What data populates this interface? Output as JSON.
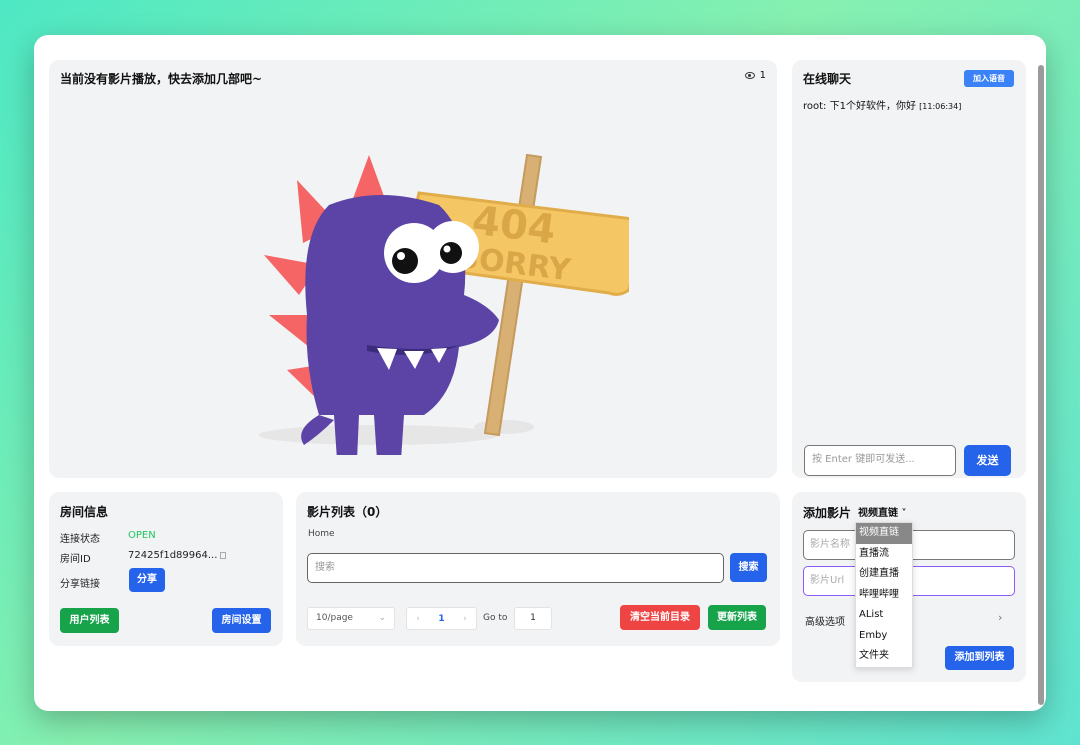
{
  "video": {
    "title": "当前没有影片播放，快去添加几部吧~",
    "viewer_count": "1",
    "error_sign_code": "404",
    "error_sign_text": "SORRY"
  },
  "chat": {
    "title": "在线聊天",
    "voice_button": "加入语音",
    "message_user": "root:",
    "message_text": "下1个好软件，你好",
    "message_time": "[11:06:34]",
    "input_placeholder": "按 Enter 键即可发送...",
    "send_button": "发送"
  },
  "room": {
    "title": "房间信息",
    "status_label": "连接状态",
    "status_value": "OPEN",
    "id_label": "房间ID",
    "id_value": "72425f1d89964...",
    "share_label": "分享链接",
    "share_button": "分享",
    "users_button": "用户列表",
    "settings_button": "房间设置"
  },
  "movie_list": {
    "title": "影片列表（0）",
    "breadcrumb": "Home",
    "search_placeholder": "搜索",
    "search_button": "搜索",
    "page_size": "10/page",
    "current_page": "1",
    "goto_label": "Go to",
    "goto_value": "1",
    "clear_button": "清空当前目录",
    "refresh_button": "更新列表"
  },
  "add_movie": {
    "title": "添加影片",
    "type_selected": "视频直链",
    "name_placeholder": "影片名称",
    "url_placeholder": "影片Url",
    "advanced_label": "高级选项",
    "add_button": "添加到列表",
    "type_options": [
      "视频直链",
      "直播流",
      "创建直播",
      "哔哩哔哩",
      "AList",
      "Emby",
      "文件夹"
    ]
  }
}
